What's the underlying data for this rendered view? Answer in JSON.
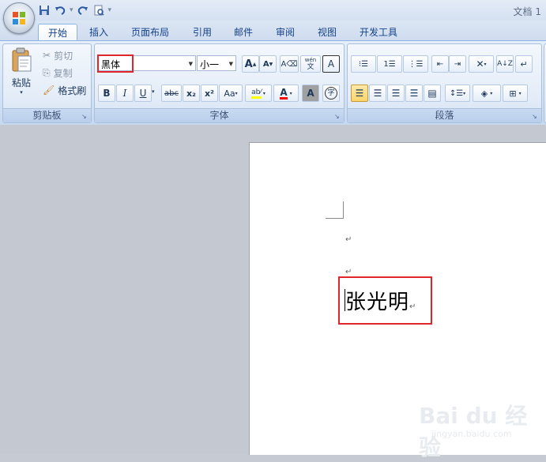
{
  "window": {
    "title": "文档 1"
  },
  "tabs": [
    "开始",
    "插入",
    "页面布局",
    "引用",
    "邮件",
    "审阅",
    "视图",
    "开发工具"
  ],
  "clipboard": {
    "paste": "粘贴",
    "cut": "剪切",
    "copy": "复制",
    "format_painter": "格式刷",
    "group_label": "剪贴板"
  },
  "font": {
    "name": "黑体",
    "size": "小一",
    "group_label": "字体",
    "grow": "A",
    "shrink": "A",
    "bold": "B",
    "italic": "I",
    "underline": "U",
    "strike": "abc",
    "subscript": "x₂",
    "superscript": "x²",
    "change_case": "Aa",
    "phonetic": "wén",
    "phonetic_char": "文",
    "border_char": "A",
    "shade_char": "A",
    "enclose_char": "字",
    "highlight_color": "#ffff00",
    "font_color": "#ff0000"
  },
  "paragraph": {
    "group_label": "段落"
  },
  "document": {
    "text": "张光明",
    "para_mark": "↵"
  },
  "watermark": {
    "main": "Bai du 经验",
    "sub": "jingyan.baidu.com"
  }
}
